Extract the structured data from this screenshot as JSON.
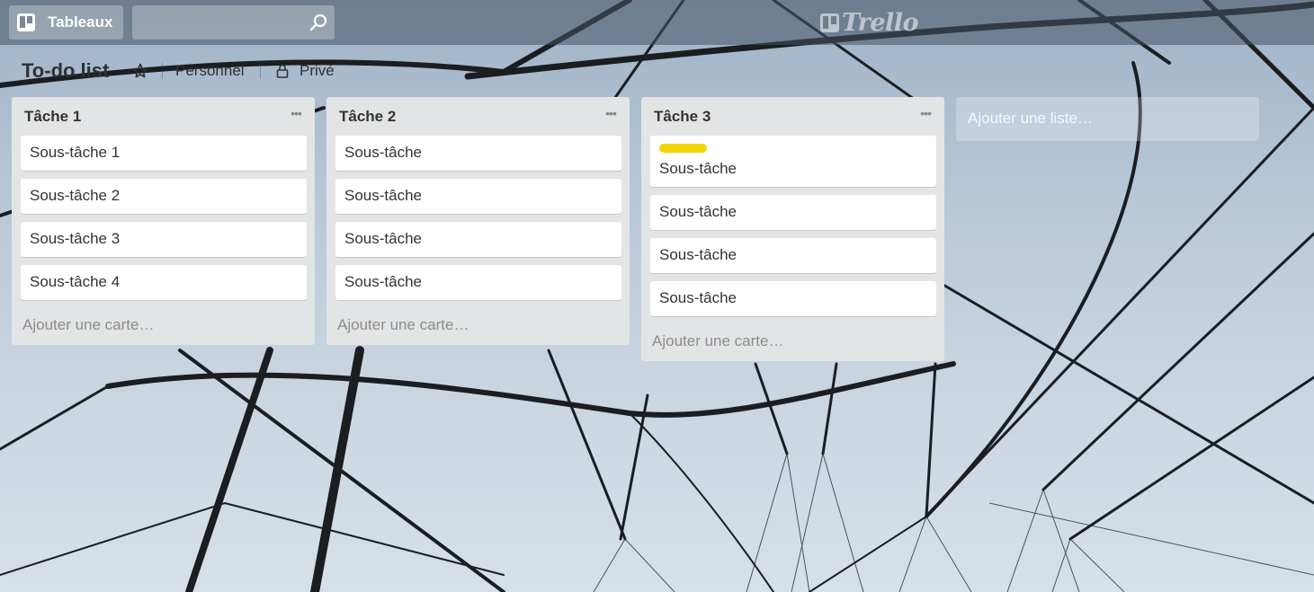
{
  "header": {
    "boards_label": "Tableaux",
    "search": {
      "value": "",
      "placeholder": ""
    },
    "logo_text": "Trello"
  },
  "board": {
    "title": "To-do list",
    "team": "Personnel",
    "visibility": "Privé"
  },
  "lists": [
    {
      "title": "Tâche 1",
      "cards": [
        {
          "title": "Sous-tâche 1"
        },
        {
          "title": "Sous-tâche 2"
        },
        {
          "title": "Sous-tâche 3"
        },
        {
          "title": "Sous-tâche 4"
        }
      ],
      "add_card": "Ajouter une carte…"
    },
    {
      "title": "Tâche 2",
      "cards": [
        {
          "title": "Sous-tâche"
        },
        {
          "title": "Sous-tâche"
        },
        {
          "title": "Sous-tâche"
        },
        {
          "title": "Sous-tâche"
        }
      ],
      "add_card": "Ajouter une carte…"
    },
    {
      "title": "Tâche 3",
      "cards": [
        {
          "title": "Sous-tâche",
          "label_color": "#f2d600"
        },
        {
          "title": "Sous-tâche"
        },
        {
          "title": "Sous-tâche"
        },
        {
          "title": "Sous-tâche"
        }
      ],
      "add_card": "Ajouter une carte…"
    }
  ],
  "add_list": "Ajouter une liste…",
  "icons": {
    "boards": "board-icon",
    "search": "search-icon",
    "star": "star-icon",
    "privacy": "lock-icon",
    "list_menu": "more-icon"
  },
  "colors": {
    "list_bg": "#e2e4e6",
    "label_yellow": "#f2d600"
  }
}
